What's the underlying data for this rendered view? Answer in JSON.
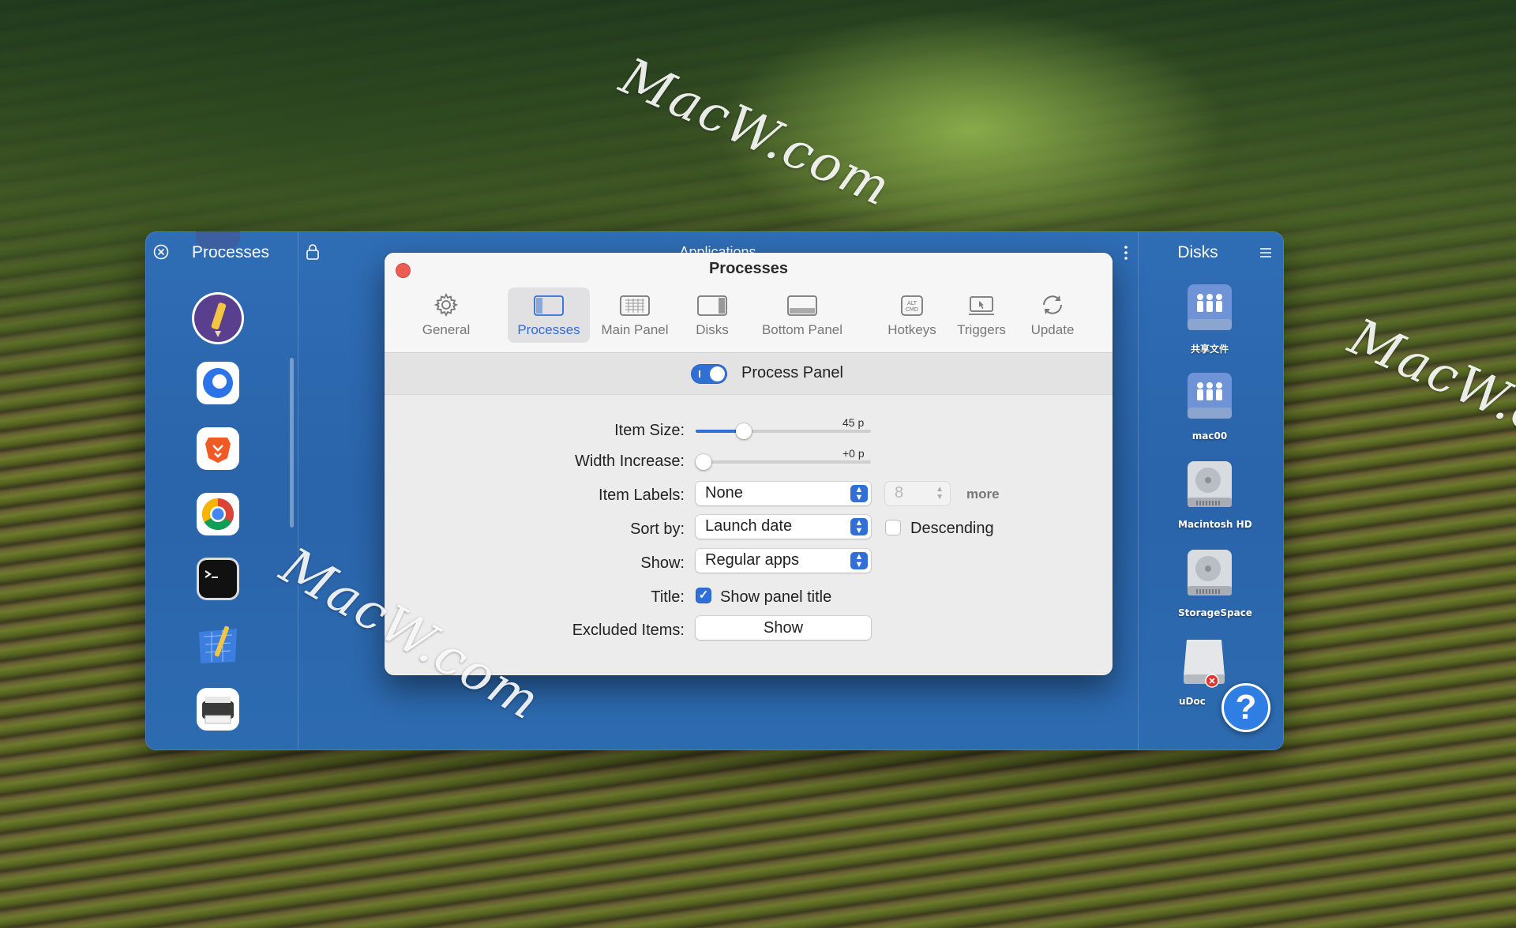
{
  "watermark": "MacW.com",
  "left_panel": {
    "title": "Processes"
  },
  "middle_panel": {
    "title": "Applications"
  },
  "right_panel": {
    "title": "Disks",
    "disks": [
      {
        "label": "共享文件",
        "icon": "network-share-icon"
      },
      {
        "label": "mac00",
        "icon": "network-share-icon"
      },
      {
        "label": "Macintosh HD",
        "icon": "hard-drive-icon"
      },
      {
        "label": "StorageSpace",
        "icon": "hard-drive-icon"
      },
      {
        "label": "uDoc",
        "icon": "external-drive-icon"
      }
    ]
  },
  "dialog": {
    "title": "Processes",
    "tabs": [
      {
        "label": "General",
        "icon": "gear-icon"
      },
      {
        "label": "Processes",
        "icon": "process-panel-icon"
      },
      {
        "label": "Main Panel",
        "icon": "main-panel-icon"
      },
      {
        "label": "Disks",
        "icon": "disks-panel-icon"
      },
      {
        "label": "Bottom Panel",
        "icon": "bottom-panel-icon"
      },
      {
        "label": "Hotkeys",
        "icon": "hotkeys-icon"
      },
      {
        "label": "Triggers",
        "icon": "triggers-icon"
      },
      {
        "label": "Update",
        "icon": "update-icon"
      }
    ],
    "active_tab": "Processes",
    "process_panel": {
      "label": "Process Panel",
      "enabled": true
    },
    "form": {
      "item_size": {
        "label": "Item Size:",
        "value_text": "45 p",
        "level": 0.25
      },
      "width_increase": {
        "label": "Width Increase:",
        "value_text": "+0 p",
        "level": 0.0
      },
      "item_labels": {
        "label": "Item Labels:",
        "value": "None",
        "count": "8",
        "more": "more"
      },
      "sort_by": {
        "label": "Sort by:",
        "value": "Launch date",
        "descending_label": "Descending",
        "descending": false
      },
      "show": {
        "label": "Show:",
        "value": "Regular apps"
      },
      "title": {
        "label": "Title:",
        "checkbox_label": "Show panel title",
        "checked": true
      },
      "excluded_items": {
        "label": "Excluded Items:",
        "button": "Show"
      }
    }
  },
  "help_button": {
    "label": "?"
  },
  "colors": {
    "accent": "#2f6fd6",
    "panel_blue": "#2d6bb0",
    "close_red": "#ee5b53"
  }
}
